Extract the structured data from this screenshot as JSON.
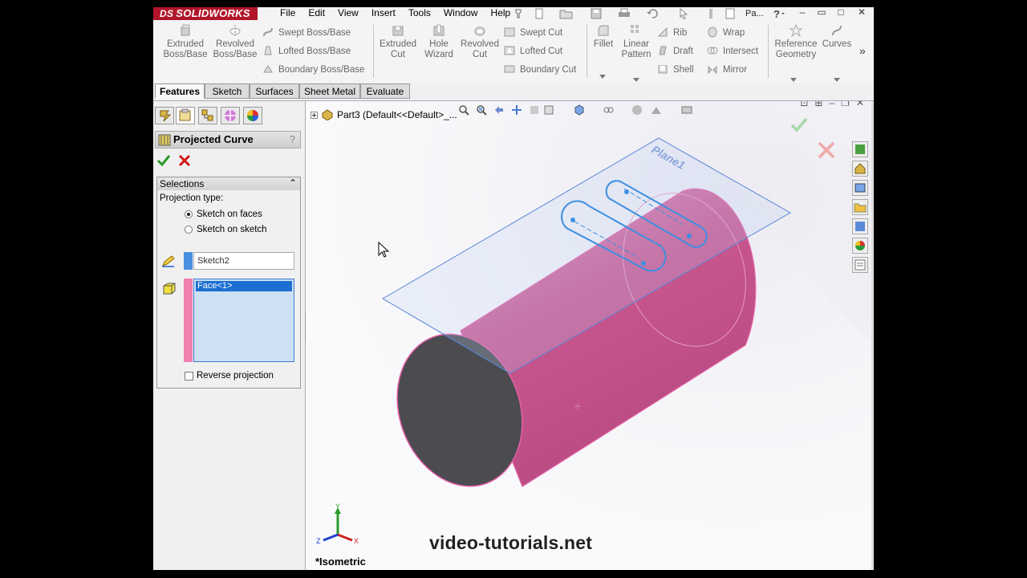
{
  "app": {
    "logo_prefix": "DS",
    "logo_text": "SOLIDWORKS",
    "doc_short": "Pa..."
  },
  "menu": [
    "File",
    "Edit",
    "View",
    "Insert",
    "Tools",
    "Window",
    "Help"
  ],
  "command_manager": {
    "big_buttons": [
      {
        "label1": "Extruded",
        "label2": "Boss/Base"
      },
      {
        "label1": "Revolved",
        "label2": "Boss/Base"
      },
      {
        "label1": "Extruded",
        "label2": "Cut"
      },
      {
        "label1": "Hole",
        "label2": "Wizard"
      },
      {
        "label1": "Revolved",
        "label2": "Cut"
      },
      {
        "label1": "Fillet",
        "label2": ""
      },
      {
        "label1": "Linear",
        "label2": "Pattern"
      },
      {
        "label1": "Reference",
        "label2": "Geometry"
      },
      {
        "label1": "Curves",
        "label2": ""
      }
    ],
    "small_buttons": [
      "Swept Boss/Base",
      "Lofted Boss/Base",
      "Boundary Boss/Base",
      "Swept Cut",
      "Lofted Cut",
      "Boundary Cut",
      "Rib",
      "Draft",
      "Shell",
      "Wrap",
      "Intersect",
      "Mirror"
    ],
    "more_glyph": "»"
  },
  "tabs": [
    "Features",
    "Sketch",
    "Surfaces",
    "Sheet Metal",
    "Evaluate"
  ],
  "property_manager": {
    "title": "Projected Curve",
    "help": "?",
    "selections": {
      "title": "Selections",
      "collapse_glyph": "⌃",
      "projection_type_label": "Projection type:",
      "option_faces": "Sketch on faces",
      "option_sketch": "Sketch on sketch",
      "sketch_value": "Sketch2",
      "face_item": "Face<1>",
      "reverse_label": "Reverse projection"
    }
  },
  "viewport": {
    "tree_root": "Part3  (Default<<Default>_...",
    "plane_label": "Plane1",
    "view_name": "*Isometric",
    "watermark": "video-tutorials.net",
    "axis_x": "X",
    "axis_y": "Y",
    "axis_z": "Z"
  },
  "colors": {
    "part_body": "#d0609a",
    "part_end_face": "#4b4b50",
    "sketch_blue": "#3d8ee0",
    "plane_outline": "#5a86d8",
    "logo_red": "#b0152a"
  }
}
